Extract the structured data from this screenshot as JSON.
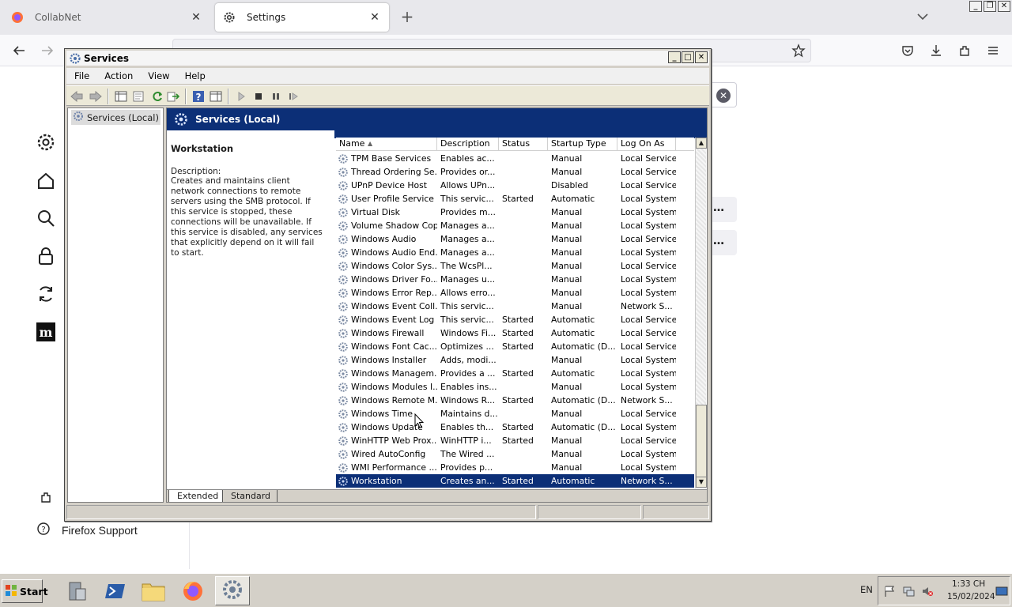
{
  "browser": {
    "tabs": [
      {
        "label": "CollabNet",
        "active": false
      },
      {
        "label": "Settings",
        "active": true
      }
    ],
    "support_link": "Firefox Support"
  },
  "services_window": {
    "title": "Services",
    "menu": [
      "File",
      "Action",
      "View",
      "Help"
    ],
    "tree_root": "Services (Local)",
    "header_title": "Services (Local)",
    "detail": {
      "service_name": "Workstation",
      "description_label": "Description:",
      "description_text": "Creates and maintains client network connections to remote servers using the SMB protocol. If this service is stopped, these connections will be unavailable. If this service is disabled, any services that explicitly depend on it will fail to start."
    },
    "columns": [
      "Name",
      "Description",
      "Status",
      "Startup Type",
      "Log On As"
    ],
    "rows": [
      {
        "name": "TPM Base Services",
        "description": "Enables ac...",
        "status": "",
        "startup": "Manual",
        "logon": "Local Service"
      },
      {
        "name": "Thread Ordering Se...",
        "description": "Provides or...",
        "status": "",
        "startup": "Manual",
        "logon": "Local Service"
      },
      {
        "name": "UPnP Device Host",
        "description": "Allows UPn...",
        "status": "",
        "startup": "Disabled",
        "logon": "Local Service"
      },
      {
        "name": "User Profile Service",
        "description": "This servic...",
        "status": "Started",
        "startup": "Automatic",
        "logon": "Local System"
      },
      {
        "name": "Virtual Disk",
        "description": "Provides m...",
        "status": "",
        "startup": "Manual",
        "logon": "Local System"
      },
      {
        "name": "Volume Shadow Copy",
        "description": "Manages a...",
        "status": "",
        "startup": "Manual",
        "logon": "Local System"
      },
      {
        "name": "Windows Audio",
        "description": "Manages a...",
        "status": "",
        "startup": "Manual",
        "logon": "Local Service"
      },
      {
        "name": "Windows Audio End...",
        "description": "Manages a...",
        "status": "",
        "startup": "Manual",
        "logon": "Local System"
      },
      {
        "name": "Windows Color Sys...",
        "description": "The WcsPl...",
        "status": "",
        "startup": "Manual",
        "logon": "Local Service"
      },
      {
        "name": "Windows Driver Fo...",
        "description": "Manages u...",
        "status": "",
        "startup": "Manual",
        "logon": "Local System"
      },
      {
        "name": "Windows Error Rep...",
        "description": "Allows erro...",
        "status": "",
        "startup": "Manual",
        "logon": "Local System"
      },
      {
        "name": "Windows Event Coll...",
        "description": "This servic...",
        "status": "",
        "startup": "Manual",
        "logon": "Network S..."
      },
      {
        "name": "Windows Event Log",
        "description": "This servic...",
        "status": "Started",
        "startup": "Automatic",
        "logon": "Local Service"
      },
      {
        "name": "Windows Firewall",
        "description": "Windows Fi...",
        "status": "Started",
        "startup": "Automatic",
        "logon": "Local Service"
      },
      {
        "name": "Windows Font Cac...",
        "description": "Optimizes ...",
        "status": "Started",
        "startup": "Automatic (D...",
        "logon": "Local Service"
      },
      {
        "name": "Windows Installer",
        "description": "Adds, modi...",
        "status": "",
        "startup": "Manual",
        "logon": "Local System"
      },
      {
        "name": "Windows Managem...",
        "description": "Provides a ...",
        "status": "Started",
        "startup": "Automatic",
        "logon": "Local System"
      },
      {
        "name": "Windows Modules I...",
        "description": "Enables ins...",
        "status": "",
        "startup": "Manual",
        "logon": "Local System"
      },
      {
        "name": "Windows Remote M...",
        "description": "Windows R...",
        "status": "Started",
        "startup": "Automatic (D...",
        "logon": "Network S..."
      },
      {
        "name": "Windows Time",
        "description": "Maintains d...",
        "status": "",
        "startup": "Manual",
        "logon": "Local Service"
      },
      {
        "name": "Windows Update",
        "description": "Enables th...",
        "status": "Started",
        "startup": "Automatic (D...",
        "logon": "Local System"
      },
      {
        "name": "WinHTTP Web Prox...",
        "description": "WinHTTP i...",
        "status": "Started",
        "startup": "Manual",
        "logon": "Local Service"
      },
      {
        "name": "Wired AutoConfig",
        "description": "The Wired ...",
        "status": "",
        "startup": "Manual",
        "logon": "Local System"
      },
      {
        "name": "WMI Performance ...",
        "description": "Provides p...",
        "status": "",
        "startup": "Manual",
        "logon": "Local System"
      },
      {
        "name": "Workstation",
        "description": "Creates an...",
        "status": "Started",
        "startup": "Automatic",
        "logon": "Network S...",
        "selected": true
      }
    ],
    "view_tabs": [
      "Extended",
      "Standard"
    ]
  },
  "taskbar": {
    "start_label": "Start",
    "language": "EN",
    "time": "1:33 CH",
    "date": "15/02/2024"
  },
  "colors": {
    "selection": "#0c2f77",
    "window_face": "#d4d0c8"
  }
}
